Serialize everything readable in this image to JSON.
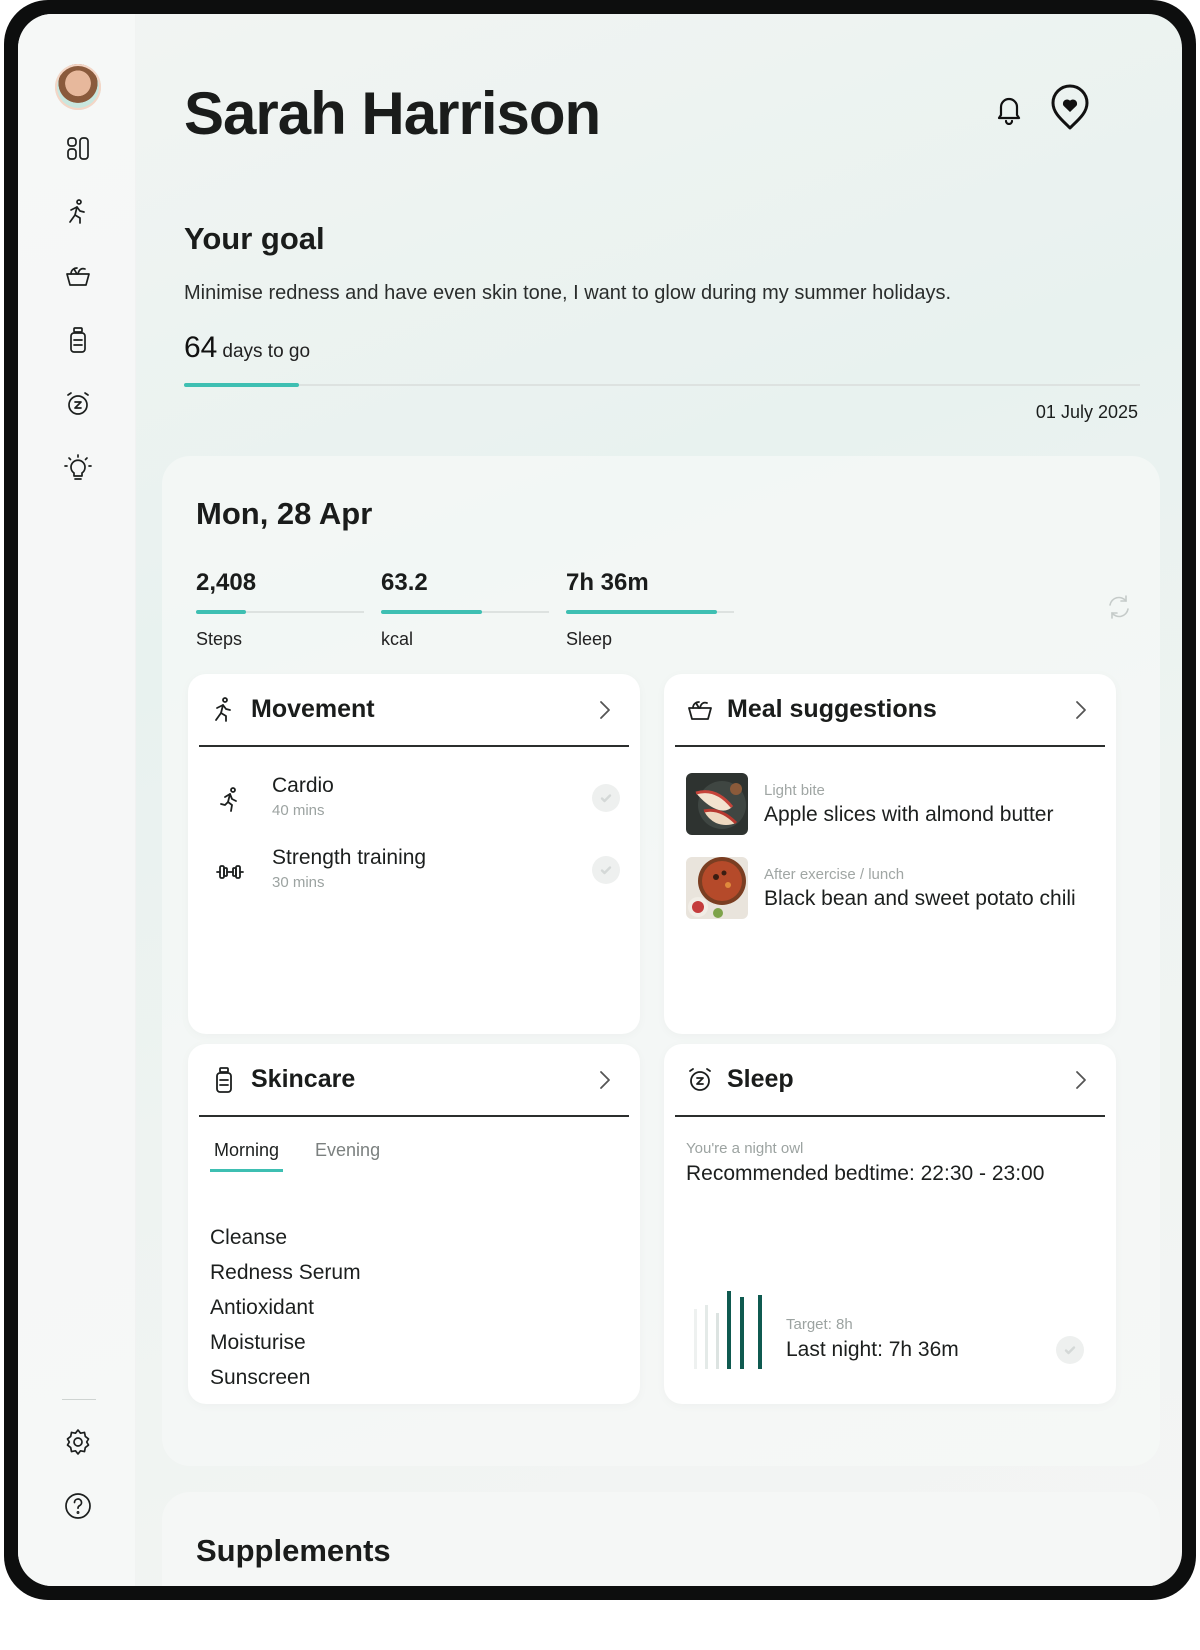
{
  "header": {
    "user_name": "Sarah Harrison",
    "icons": [
      "bell-icon",
      "heart-location-icon"
    ]
  },
  "sidebar": {
    "items": [
      {
        "name": "dashboard",
        "icon": "grid-icon"
      },
      {
        "name": "movement",
        "icon": "running-person-icon"
      },
      {
        "name": "meals",
        "icon": "bowl-icon"
      },
      {
        "name": "skincare",
        "icon": "bottle-icon"
      },
      {
        "name": "sleep",
        "icon": "alarm-clock-icon"
      },
      {
        "name": "tips",
        "icon": "lightbulb-icon"
      }
    ],
    "bottom": [
      {
        "name": "settings",
        "icon": "gear-icon"
      },
      {
        "name": "help",
        "icon": "question-icon"
      }
    ]
  },
  "goal": {
    "title": "Your goal",
    "text": "Minimise redness and have even skin tone, I want to glow during my summer holidays.",
    "days_number": "64",
    "days_label": "days to go",
    "date": "01 July 2025",
    "progress": 0.12
  },
  "today": {
    "title": "Mon, 28 Apr",
    "stats": [
      {
        "value": "2,408",
        "label": "Steps",
        "progress": 0.3
      },
      {
        "value": "63.2",
        "label": "kcal",
        "progress": 0.6
      },
      {
        "value": "7h 36m",
        "label": "Sleep",
        "progress": 0.9
      }
    ]
  },
  "movement": {
    "title": "Movement",
    "items": [
      {
        "name": "Cardio",
        "duration": "40 mins",
        "icon": "running-icon"
      },
      {
        "name": "Strength training",
        "duration": "30 mins",
        "icon": "dumbbell-icon"
      }
    ]
  },
  "meals": {
    "title": "Meal suggestions",
    "items": [
      {
        "tag": "Light bite",
        "name": "Apple slices with almond butter"
      },
      {
        "tag": "After exercise / lunch",
        "name": "Black bean and sweet potato chili"
      }
    ]
  },
  "skincare": {
    "title": "Skincare",
    "tabs": [
      "Morning",
      "Evening"
    ],
    "active_tab": "Morning",
    "steps": [
      "Cleanse",
      "Redness Serum",
      "Antioxidant",
      "Moisturise",
      "Sunscreen"
    ]
  },
  "sleep": {
    "title": "Sleep",
    "subtitle": "You're a night owl",
    "recommendation": "Recommended bedtime: 22:30 - 23:00",
    "target": "Target: 8h",
    "last_night": "Last night: 7h 36m"
  },
  "supplements": {
    "title": "Supplements"
  },
  "colors": {
    "accent": "#3ebfb2",
    "dark_bar": "#0f5a50"
  }
}
